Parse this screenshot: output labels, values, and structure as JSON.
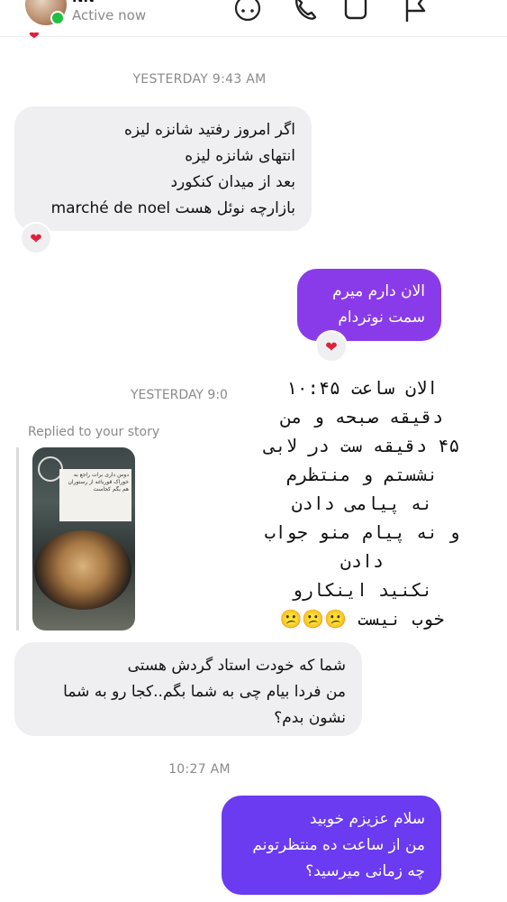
{
  "header": {
    "name": "NN",
    "status": "Active now",
    "icons": [
      "avatar-face-icon",
      "phone-icon",
      "video-icon",
      "flag-icon"
    ]
  },
  "messages": {
    "ts1": "YESTERDAY 9:43 AM",
    "m1_lines": [
      "اگر امروز رفتید شانزه لیزه",
      "انتهای شانزه لیزه",
      "بعد از میدان کنکورد",
      "بازارچه نوئل هست marché de noel"
    ],
    "m2_lines": [
      "الان دارم میرم",
      "سمت نوتردام"
    ],
    "ts2": "YESTERDAY 9:0",
    "replied_label": "Replied to your story",
    "story_caption": "دوس داری برات راجع به خوراک قورباغه از رستوران هم بگم کجاست",
    "overlay_lines": [
      "الان ساعت ۱۰:۴۵",
      "دقیقه صبحه  و من",
      "۴۵ دقیقه ست در لابی",
      "نشستم و منتظرم",
      "نه پیامی دادن",
      "و نه پیام منو جواب",
      "دادن",
      "نکنید اینکارو",
      "خوب نیست 😕😕😕"
    ],
    "m3_lines": [
      "شما که خودت استاد گردش هستی",
      "من فردا بیام چی به شما بگم..کجا رو به شما",
      "نشون بدم؟"
    ],
    "ts3": "10:27 AM",
    "m4_lines": [
      "سلام عزیزم خوبید",
      "من از ساعت ده منتظرتونم",
      "چه زمانی میرسید؟"
    ]
  },
  "reactions": {
    "heart": "❤"
  },
  "colors": {
    "accent_purple": "#8a3be9",
    "accent_violet": "#6a3bf0",
    "incoming": "#efeff1",
    "online": "#20c040"
  }
}
